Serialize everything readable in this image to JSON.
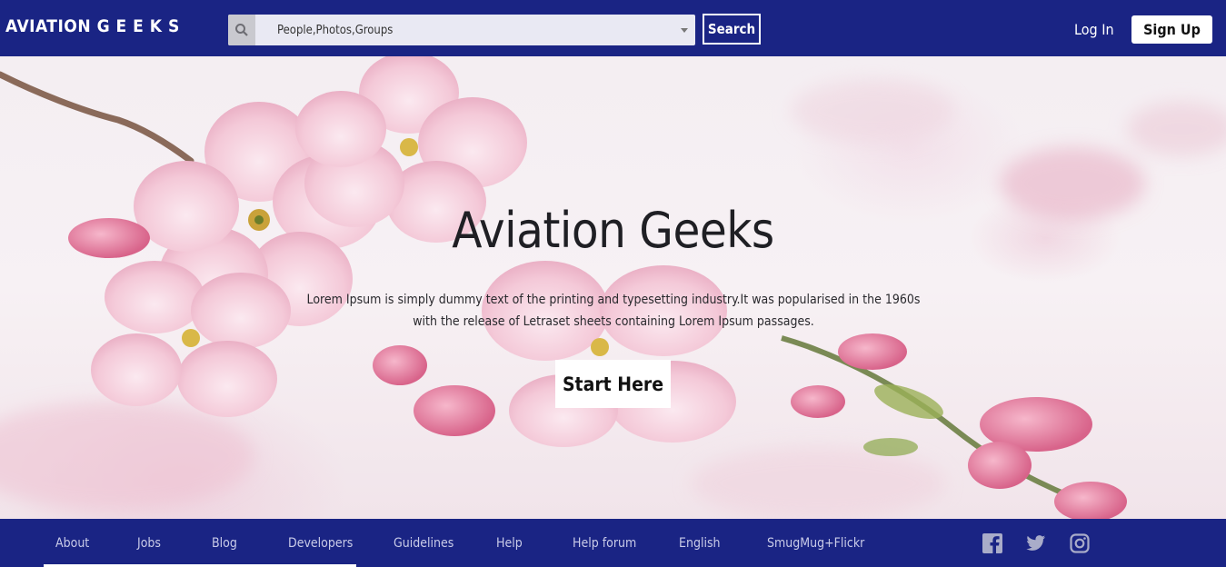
{
  "header": {
    "brand": "AVIATION G E E K S",
    "search": {
      "value": "People,Photos,Groups",
      "icon": "search-icon"
    },
    "search_button": "Search",
    "login": "Log In",
    "signup": "Sign Up"
  },
  "hero": {
    "title": "Aviation Geeks",
    "description": "Lorem Ipsum is simply dummy text of the printing and typesetting industry.It was popularised in the 1960s with the release of Letraset sheets containing Lorem Ipsum passages.",
    "cta": "Start Here"
  },
  "footer": {
    "links": [
      "About",
      "Jobs",
      "Blog",
      "Developers",
      "Guidelines",
      "Help",
      "Help forum",
      "English",
      "SmugMug+Flickr"
    ],
    "social": [
      "facebook-icon",
      "twitter-icon",
      "instagram-icon"
    ]
  },
  "colors": {
    "nav": "#1a2484",
    "blossom": "#f3c6d6",
    "text": "#1f1f24"
  }
}
